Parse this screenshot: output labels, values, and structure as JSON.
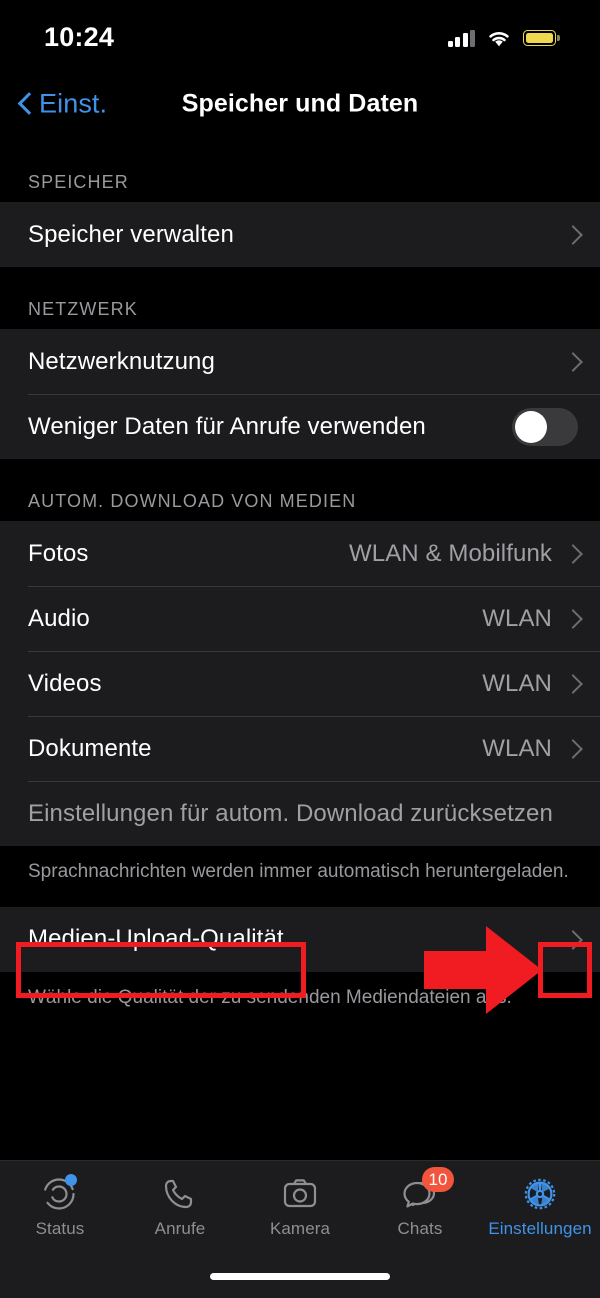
{
  "status_bar": {
    "time": "10:24",
    "signal_icon": "cellular-signal-icon",
    "wifi_icon": "wifi-icon",
    "battery_icon": "battery-low-power-icon",
    "battery_color": "#f0d84e"
  },
  "nav": {
    "back_label": "Einst.",
    "back_icon": "chevron-left-icon",
    "title": "Speicher und Daten",
    "accent_color": "#3f93e8"
  },
  "sections": [
    {
      "header": "SPEICHER",
      "footer": "",
      "rows": [
        {
          "label": "Speicher verwalten",
          "value": "",
          "accessory": "chevron"
        }
      ]
    },
    {
      "header": "NETZWERK",
      "footer": "",
      "rows": [
        {
          "label": "Netzwerknutzung",
          "value": "",
          "accessory": "chevron"
        },
        {
          "label": "Weniger Daten für Anrufe verwenden",
          "value": "",
          "accessory": "toggle-off"
        }
      ]
    },
    {
      "header": "AUTOM. DOWNLOAD VON MEDIEN",
      "footer": "Sprachnachrichten werden immer automatisch heruntergeladen.",
      "rows": [
        {
          "label": "Fotos",
          "value": "WLAN & Mobilfunk",
          "accessory": "chevron"
        },
        {
          "label": "Audio",
          "value": "WLAN",
          "accessory": "chevron"
        },
        {
          "label": "Videos",
          "value": "WLAN",
          "accessory": "chevron"
        },
        {
          "label": "Dokumente",
          "value": "WLAN",
          "accessory": "chevron"
        },
        {
          "label": "Einstellungen für autom. Download zurücksetzen",
          "value": "",
          "accessory": "none"
        }
      ]
    },
    {
      "header": "",
      "footer": "Wähle die Qualität der zu sendenden Mediendateien aus.",
      "rows": [
        {
          "label": "Medien-Upload-Qualität",
          "value": "",
          "accessory": "chevron"
        }
      ]
    }
  ],
  "annotation": {
    "highlight_color": "#f01c21",
    "arrow_color": "#f01c21",
    "label_box_target": "Medien-Upload-Qualität",
    "chevron_box_target": "medien-upload-qualitaet-chevron"
  },
  "tabbar": {
    "items": [
      {
        "label": "Status",
        "icon": "status-rings-icon",
        "active": false,
        "badge": "",
        "dot": true
      },
      {
        "label": "Anrufe",
        "icon": "phone-icon",
        "active": false,
        "badge": "",
        "dot": false
      },
      {
        "label": "Kamera",
        "icon": "camera-icon",
        "active": false,
        "badge": "",
        "dot": false
      },
      {
        "label": "Chats",
        "icon": "chat-bubbles-icon",
        "active": false,
        "badge": "10",
        "dot": false
      },
      {
        "label": "Einstellungen",
        "icon": "gear-icon",
        "active": true,
        "badge": "",
        "dot": false
      }
    ],
    "active_color": "#3f93e8",
    "inactive_color": "#8e8e93",
    "badge_color": "#f2553d"
  }
}
